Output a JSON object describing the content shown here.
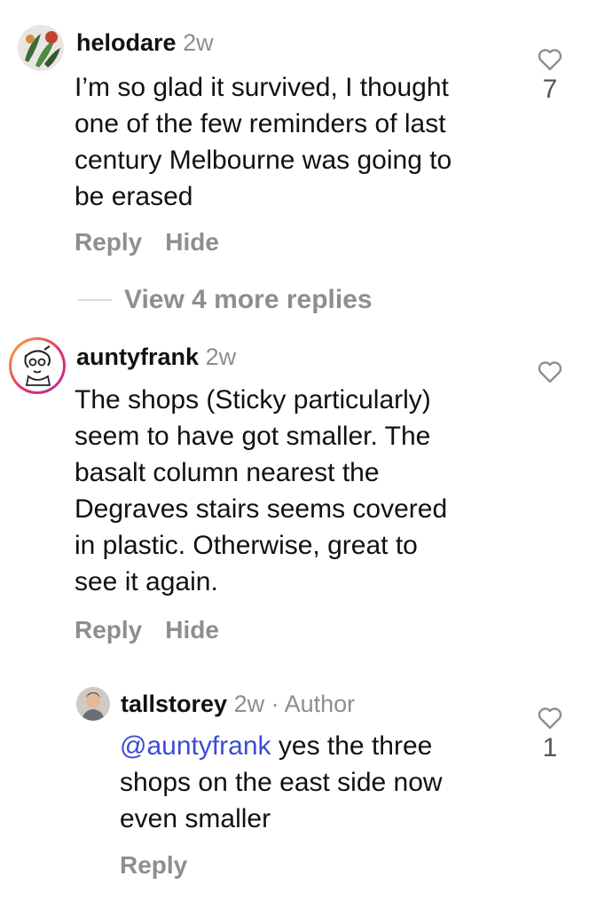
{
  "comments": [
    {
      "username": "helodare",
      "time": "2w",
      "text_lines": [
        "I’m so glad it survived, I thought",
        "one of the few reminders of last",
        "century Melbourne was going to",
        "be erased"
      ],
      "reply_label": "Reply",
      "hide_label": "Hide",
      "like_count": "7",
      "avatar_icon": "leaf-avatar"
    },
    {
      "username": "auntyfrank",
      "time": "2w",
      "text_lines": [
        "The shops (Sticky particularly)",
        "seem to have got smaller. The",
        "basalt column nearest the",
        "Degraves stairs seems covered",
        "in plastic. Otherwise, great to",
        "see it again."
      ],
      "reply_label": "Reply",
      "hide_label": "Hide",
      "like_count": "",
      "avatar_icon": "sketch-avatar"
    },
    {
      "username": "tallstorey",
      "time": "2w",
      "author_tag": "· Author",
      "mention": "@auntyfrank",
      "text_lines": [
        " yes the three",
        "shops on the east side now",
        "even smaller"
      ],
      "reply_label": "Reply",
      "like_count": "1",
      "avatar_icon": "person-avatar"
    }
  ],
  "view_more_replies": "View 4 more replies",
  "colors": {
    "mention": "#3c4bd6",
    "secondary": "#8e8e8e",
    "story_ring": "#e1306c"
  }
}
